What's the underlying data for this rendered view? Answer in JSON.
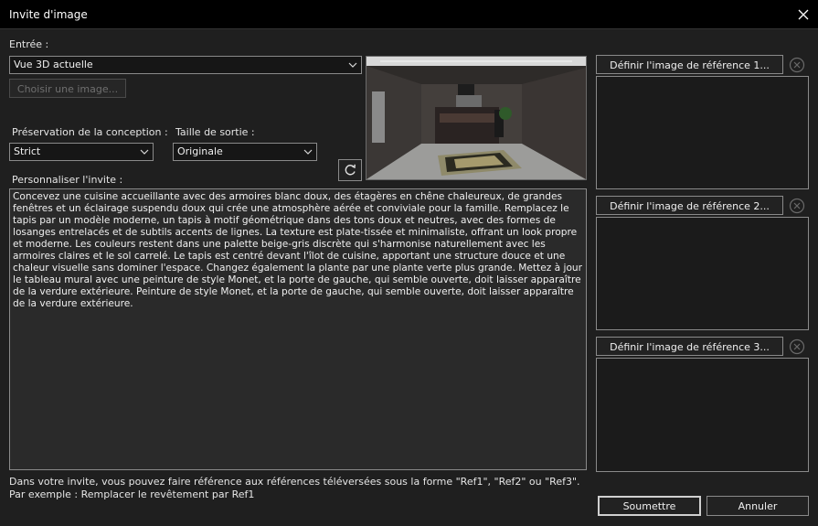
{
  "window": {
    "title": "Invite d'image"
  },
  "input": {
    "label": "Entrée :",
    "source_value": "Vue 3D actuelle",
    "choose_image_label": "Choisir une image..."
  },
  "design_preservation": {
    "label": "Préservation de la conception :",
    "value": "Strict"
  },
  "output_size": {
    "label": "Taille de sortie :",
    "value": "Originale"
  },
  "prompt": {
    "label": "Personnaliser l'invite :",
    "text": "Concevez une cuisine accueillante avec des armoires blanc doux, des étagères en chêne chaleureux, de grandes fenêtres et un éclairage suspendu doux qui crée une atmosphère aérée et conviviale pour la famille. Remplacez le tapis par un modèle moderne, un tapis à motif géométrique dans des tons doux et neutres, avec des formes de losanges entrelacés et de subtils accents de lignes. La texture est plate-tissée et minimaliste, offrant un look propre et moderne. Les couleurs restent dans une palette beige-gris discrète qui s'harmonise naturellement avec les armoires claires et le sol carrelé. Le tapis est centré devant l'îlot de cuisine, apportant une structure douce et une chaleur visuelle sans dominer l'espace. Changez également la plante par une plante verte plus grande. Mettez à jour le tableau mural avec une peinture de style Monet, et la porte de gauche, qui semble ouverte, doit laisser apparaître de la verdure extérieure. Peinture de style Monet, et la porte de gauche, qui semble ouverte, doit laisser apparaître de la verdure extérieure."
  },
  "references": [
    {
      "button_label": "Définir l'image de référence 1..."
    },
    {
      "button_label": "Définir l'image de référence 2..."
    },
    {
      "button_label": "Définir l'image de référence 3..."
    }
  ],
  "hints": {
    "line1": "Dans votre invite, vous pouvez faire référence aux références téléversées sous la forme \"Ref1\", \"Ref2\" ou \"Ref3\".",
    "line2": "Par exemple : Remplacer le revêtement par Ref1"
  },
  "footer": {
    "submit_label": "Soumettre",
    "cancel_label": "Annuler"
  },
  "icons": {
    "close": "close-icon",
    "chevron": "chevron-down-icon",
    "refresh": "refresh-icon",
    "remove": "remove-circle-icon"
  }
}
